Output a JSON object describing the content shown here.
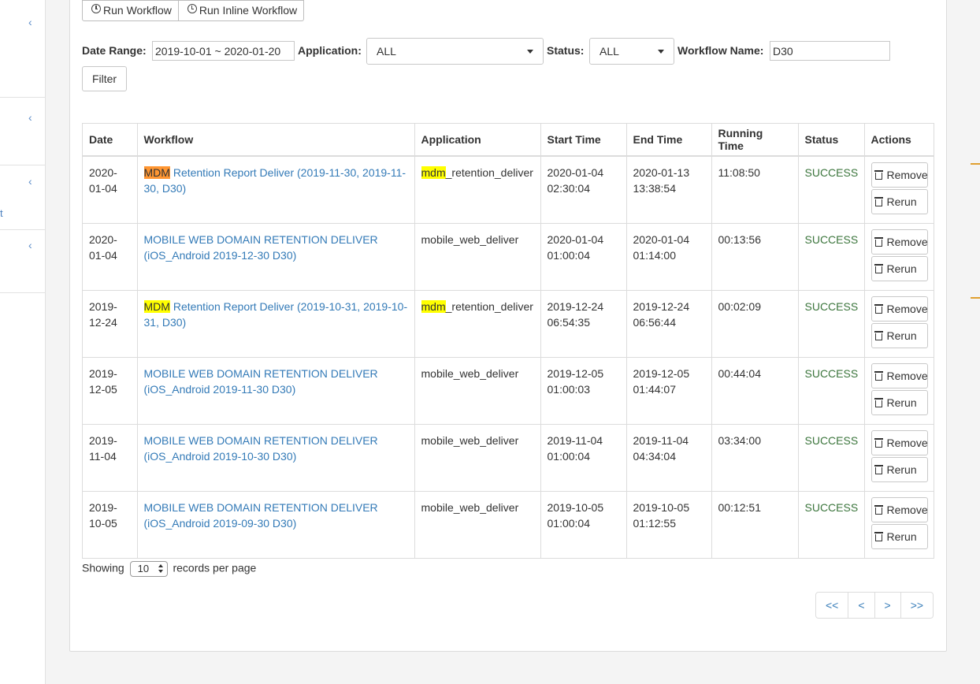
{
  "sidebar": {
    "fragment_text": "t"
  },
  "toolbar": {
    "run_workflow_label": "Run Workflow",
    "run_inline_workflow_label": "Run Inline Workflow"
  },
  "filters": {
    "date_range_label": "Date Range:",
    "date_range_value": "2019-10-01 ~ 2020-01-20",
    "application_label": "Application:",
    "application_value": "ALL",
    "status_label": "Status:",
    "status_value": "ALL",
    "workflow_name_label": "Workflow Name:",
    "workflow_name_value": "D30",
    "filter_button": "Filter"
  },
  "table": {
    "headers": [
      "Date",
      "Workflow",
      "Application",
      "Start Time",
      "End Time",
      "Running Time",
      "Status",
      "Actions"
    ],
    "remove_label": "Remove",
    "rerun_label": "Rerun",
    "rows": [
      {
        "date": "2020-01-04",
        "workflow_hl": "MDM",
        "workflow_rest": " Retention Report Deliver (2019-11-30, 2019-11-30, D30)",
        "app_hl": "mdm",
        "app_rest": "_retention_deliver",
        "start": "2020-01-04 02:30:04",
        "end": "2020-01-13 13:38:54",
        "running": "11:08:50",
        "status": "SUCCESS"
      },
      {
        "date": "2020-01-04",
        "workflow_hl": "",
        "workflow_rest": "MOBILE WEB DOMAIN RETENTION DELIVER (iOS_Android 2019-12-30 D30)",
        "app_hl": "",
        "app_rest": "mobile_web_deliver",
        "start": "2020-01-04 01:00:04",
        "end": "2020-01-04 01:14:00",
        "running": "00:13:56",
        "status": "SUCCESS"
      },
      {
        "date": "2019-12-24",
        "workflow_hl": "MDM",
        "workflow_rest": " Retention Report Deliver (2019-10-31, 2019-10-31, D30)",
        "app_hl": "mdm",
        "app_rest": "_retention_deliver",
        "start": "2019-12-24 06:54:35",
        "end": "2019-12-24 06:56:44",
        "running": "00:02:09",
        "status": "SUCCESS"
      },
      {
        "date": "2019-12-05",
        "workflow_hl": "",
        "workflow_rest": "MOBILE WEB DOMAIN RETENTION DELIVER (iOS_Android 2019-11-30 D30)",
        "app_hl": "",
        "app_rest": "mobile_web_deliver",
        "start": "2019-12-05 01:00:03",
        "end": "2019-12-05 01:44:07",
        "running": "00:44:04",
        "status": "SUCCESS"
      },
      {
        "date": "2019-11-04",
        "workflow_hl": "",
        "workflow_rest": "MOBILE WEB DOMAIN RETENTION DELIVER (iOS_Android 2019-10-30 D30)",
        "app_hl": "",
        "app_rest": "mobile_web_deliver",
        "start": "2019-11-04 01:00:04",
        "end": "2019-11-04 04:34:04",
        "running": "03:34:00",
        "status": "SUCCESS"
      },
      {
        "date": "2019-10-05",
        "workflow_hl": "",
        "workflow_rest": "MOBILE WEB DOMAIN RETENTION DELIVER (iOS_Android 2019-09-30 D30)",
        "app_hl": "",
        "app_rest": "mobile_web_deliver",
        "start": "2019-10-05 01:00:04",
        "end": "2019-10-05 01:12:55",
        "running": "00:12:51",
        "status": "SUCCESS"
      }
    ]
  },
  "footer": {
    "showing_label": "Showing",
    "per_page_value": "10",
    "records_label": "records per page"
  },
  "pagination": {
    "first": "<<",
    "prev": "<",
    "next": ">",
    "last": ">>"
  },
  "colors": {
    "link": "#337ab7",
    "success": "#3c763d",
    "highlight": "#ffff00",
    "highlight_active": "#ff9632"
  }
}
